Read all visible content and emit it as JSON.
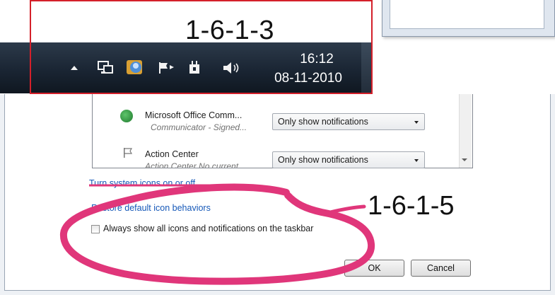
{
  "annotations": {
    "top_label": "1-6-1-3",
    "side_label": "1-6-1-5",
    "colors": {
      "frame": "#d4202a",
      "marker": "#e0367a"
    }
  },
  "taskbar": {
    "icons": [
      "show-hidden-icons-arrow",
      "network-icon",
      "communicator-icon",
      "action-center-flag-icon",
      "power-icon",
      "volume-icon"
    ],
    "clock_time": "16:12",
    "clock_date": "08-11-2010"
  },
  "dialog": {
    "rows": [
      {
        "name": "Microsoft Office Comm...",
        "sub": "Communicator - Signed...",
        "behavior": "Only show notifications",
        "icon": "communicator-icon"
      },
      {
        "name": "Action Center",
        "sub": "Action Center  No current",
        "behavior": "Only show notifications",
        "icon": "flag-icon"
      }
    ],
    "links": {
      "system_icons": "Turn system icons on or off",
      "restore": "Restore default icon behaviors"
    },
    "checkbox_label": "Always show all icons and notifications on the taskbar",
    "checkbox_checked": false,
    "buttons": {
      "ok": "OK",
      "cancel": "Cancel"
    }
  }
}
